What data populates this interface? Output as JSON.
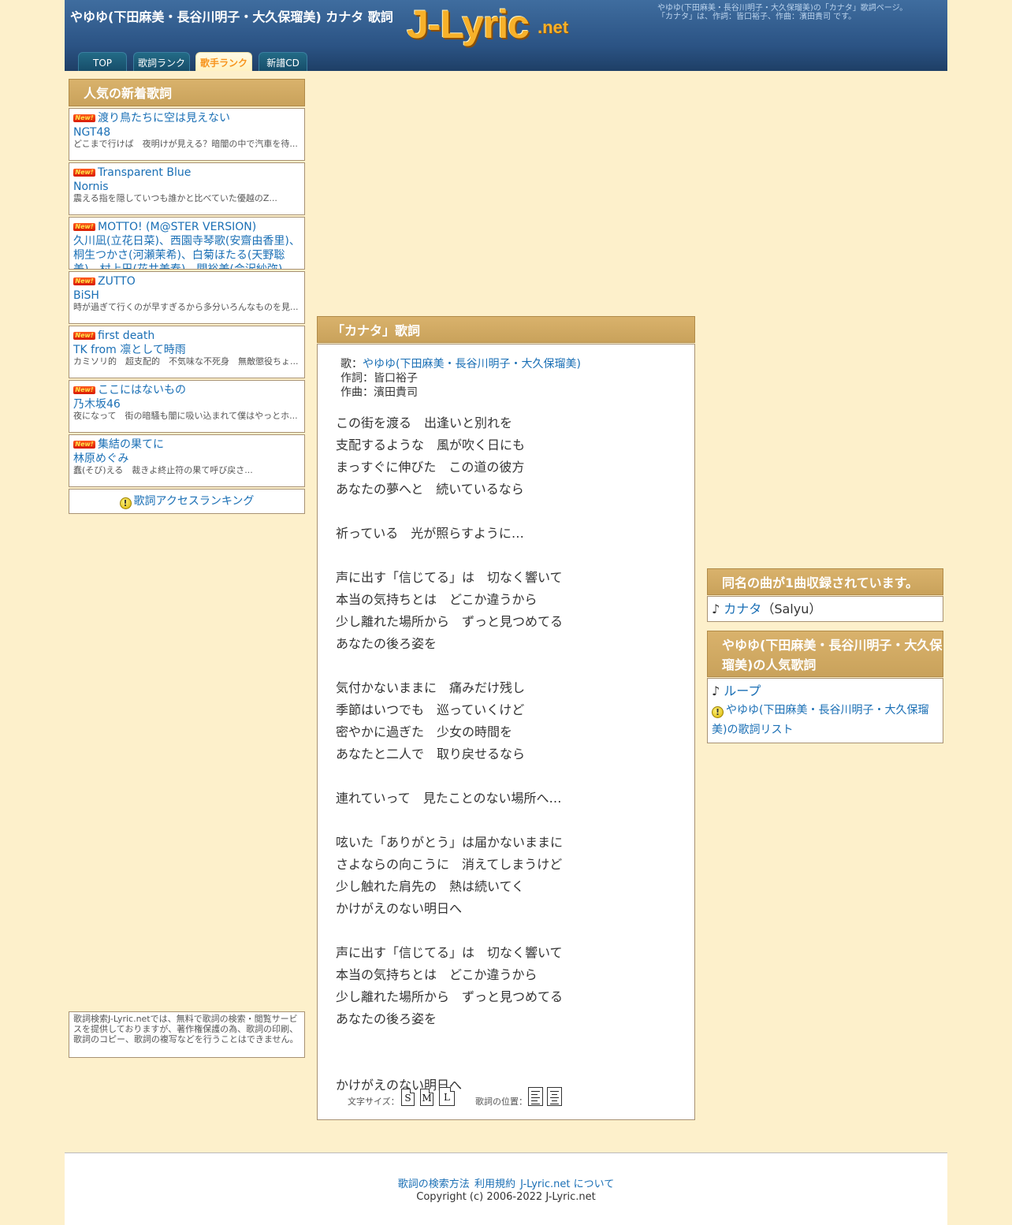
{
  "header": {
    "title": "やゆゆ(下田麻美・長谷川明子・大久保瑠美) カナタ 歌詞",
    "logo_main": "J-Lyric",
    "logo_suffix": ".net",
    "desc_line1": "やゆゆ(下田麻美・長谷川明子・大久保瑠美)の「カナタ」歌詞ページ。",
    "desc_line2": "「カナタ」は、作詞：皆口裕子、作曲：濱田貴司 です。"
  },
  "nav": {
    "tabs": [
      {
        "label": "TOP"
      },
      {
        "label": "歌詞ランク"
      },
      {
        "label": "歌手ランク",
        "active": true
      },
      {
        "label": "新譜CD"
      }
    ]
  },
  "sidebar_left": {
    "heading": "人気の新着歌詞",
    "badge": "New!",
    "items": [
      {
        "title": "渡り鳥たちに空は見えない",
        "artist": "NGT48",
        "snippet": "どこまで行けば　夜明けが見える？暗闇の中で汽車を待..."
      },
      {
        "title": "Transparent Blue",
        "artist": "Nornis",
        "snippet": "震える指を隠していつも誰かと比べていた優越のZ..."
      },
      {
        "title": "MOTTO! (M@STER VERSION)",
        "artist": "久川凪(立花日菜)、西園寺琴歌(安齋由香里)、桐生つかさ(河瀬茉希)、白菊ほたる(天野聡美)、村上巴(花井美春)、関裕美(会沢紗弥)",
        "snippet": ""
      },
      {
        "title": "ZUTTO",
        "artist": "BiSH",
        "snippet": "時が過ぎて行くのが早すぎるから多分いろんなものを見..."
      },
      {
        "title": "first death",
        "artist": "TK from 凛として時雨",
        "snippet": "カミソリ的　超支配的　不気味な不死身　無敵懲役ちょ..."
      },
      {
        "title": "ここにはないもの",
        "artist": "乃木坂46",
        "snippet": "夜になって　街の暗騒も闇に吸い込まれて僕はやっとホ..."
      },
      {
        "title": "集結の果てに",
        "artist": "林原めぐみ",
        "snippet": "蠢(そび)える　裁きよ終止符の果て呼び戻さ..."
      }
    ],
    "ranking_link": "歌詞アクセスランキング",
    "notice": "歌詞検索J-Lyric.netでは、無料で歌詞の検索・閲覧サービスを提供しておりますが、著作権保護の為、歌詞の印刷、歌詞のコピー、歌詞の複写などを行うことはできません。"
  },
  "lyric_panel": {
    "heading": "「カナタ」歌詞",
    "singer_label": "歌：",
    "singer": "やゆゆ(下田麻美・長谷川明子・大久保瑠美)",
    "lyricist": "作詞：皆口裕子",
    "composer": "作曲：濱田貴司",
    "lines": [
      "この街を渡る　出逢いと別れを",
      "支配するような　風が吹く日にも",
      "まっすぐに伸びた　この道の彼方",
      "あなたの夢へと　続いているなら",
      "",
      "祈っている　光が照らすように…",
      "",
      "声に出す「信じてる」は　切なく響いて",
      "本当の気持ちとは　どこか違うから",
      "少し離れた場所から　ずっと見つめてる",
      "あなたの後ろ姿を",
      "",
      "気付かないままに　痛みだけ残し",
      "季節はいつでも　巡っていくけど",
      "密やかに過ぎた　少女の時間を",
      "あなたと二人で　取り戻せるなら",
      "",
      "連れていって　見たことのない場所へ…",
      "",
      "呟いた「ありがとう」は届かないままに",
      "さよならの向こうに　消えてしまうけど",
      "少し触れた肩先の　熱は続いてく",
      "かけがえのない明日へ",
      "",
      "声に出す「信じてる」は　切なく響いて",
      "本当の気持ちとは　どこか違うから",
      "少し離れた場所から　ずっと見つめてる",
      "あなたの後ろ姿を",
      "",
      "",
      "かけがえのない明日へ"
    ],
    "font_size_label": "文字サイズ：",
    "size_options": [
      "S",
      "M",
      "L"
    ],
    "position_label": "歌詞の位置："
  },
  "sidebar_right": {
    "same_title_heading": "同名の曲が1曲収録されています。",
    "same_title_song": "カナタ",
    "same_title_artist": "（Salyu）",
    "popular_heading": "やゆゆ(下田麻美・長谷川明子・大久保瑠美)の人気歌詞",
    "popular_song": "ループ",
    "artist_list_link": "やゆゆ(下田麻美・長谷川明子・大久保瑠美)の歌詞リスト"
  },
  "footer": {
    "links": [
      "歌詞の検索方法",
      "利用規約",
      "J-Lyric.net について"
    ],
    "copyright": "Copyright (c) 2006-2022 J-Lyric.net"
  },
  "colors": {
    "page_bg": "#fdf0cb",
    "header_bg": "#2b5384",
    "panel_head": "#cfa862",
    "link": "#1a6fb5",
    "active_tab_text": "#f7941d"
  }
}
